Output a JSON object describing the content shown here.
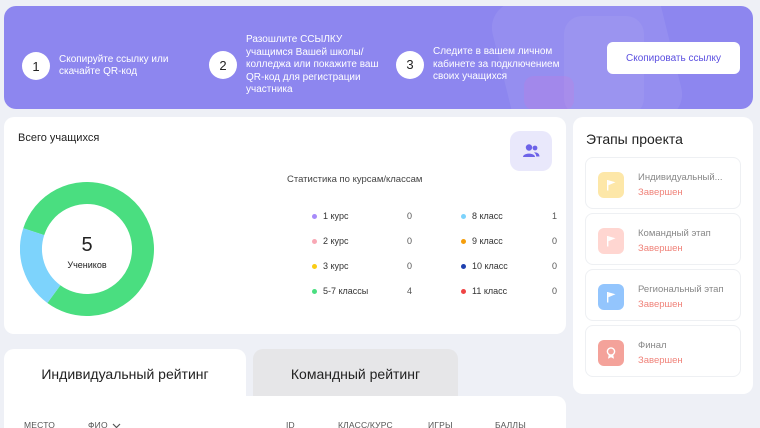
{
  "banner": {
    "steps": [
      {
        "num": "1",
        "text": "Скопируйте ссылку или скачайте QR-код"
      },
      {
        "num": "2",
        "text": "Разошлите ССЫЛКУ учащимся Вашей школы/колледжа или покажите ваш QR-код для регистрации участника"
      },
      {
        "num": "3",
        "text": "Следите в вашем личном кабинете за подключением своих учащихся"
      }
    ],
    "copy_button": "Скопировать ссылку"
  },
  "students": {
    "title": "Всего учащихся",
    "total": "5",
    "total_label": "Учеников",
    "stats_title": "Статистика по курсам/классам",
    "breakdown": [
      {
        "label": "1 курс",
        "value": "0",
        "color": "#a78bfa"
      },
      {
        "label": "2 курс",
        "value": "0",
        "color": "#f9a8b5"
      },
      {
        "label": "3 курс",
        "value": "0",
        "color": "#facc15"
      },
      {
        "label": "5-7 классы",
        "value": "4",
        "color": "#4ade80"
      },
      {
        "label": "8 класс",
        "value": "1",
        "color": "#7dd3fc"
      },
      {
        "label": "9 класс",
        "value": "0",
        "color": "#f59e0b"
      },
      {
        "label": "10 класс",
        "value": "0",
        "color": "#1e40af"
      },
      {
        "label": "11 класс",
        "value": "0",
        "color": "#ef4444"
      }
    ]
  },
  "stages": {
    "title": "Этапы проекта",
    "items": [
      {
        "name": "Индивидуальный...",
        "status": "Завершен",
        "icon": "flag-icon",
        "color": "#fde7a8"
      },
      {
        "name": "Командный этап",
        "status": "Завершен",
        "icon": "flag-icon",
        "color": "#ffd6d1"
      },
      {
        "name": "Региональный этап",
        "status": "Завершен",
        "icon": "flag-icon",
        "color": "#93c5fd"
      },
      {
        "name": "Финал",
        "status": "Завершен",
        "icon": "medal-icon",
        "color": "#f4a29a"
      }
    ]
  },
  "ranking": {
    "tabs": [
      "Индивидуальный рейтинг",
      "Командный рейтинг"
    ],
    "columns": [
      "МЕСТО",
      "ФИО",
      "ID",
      "КЛАСС/КУРС",
      "ИГРЫ",
      "БАЛЛЫ"
    ]
  }
}
